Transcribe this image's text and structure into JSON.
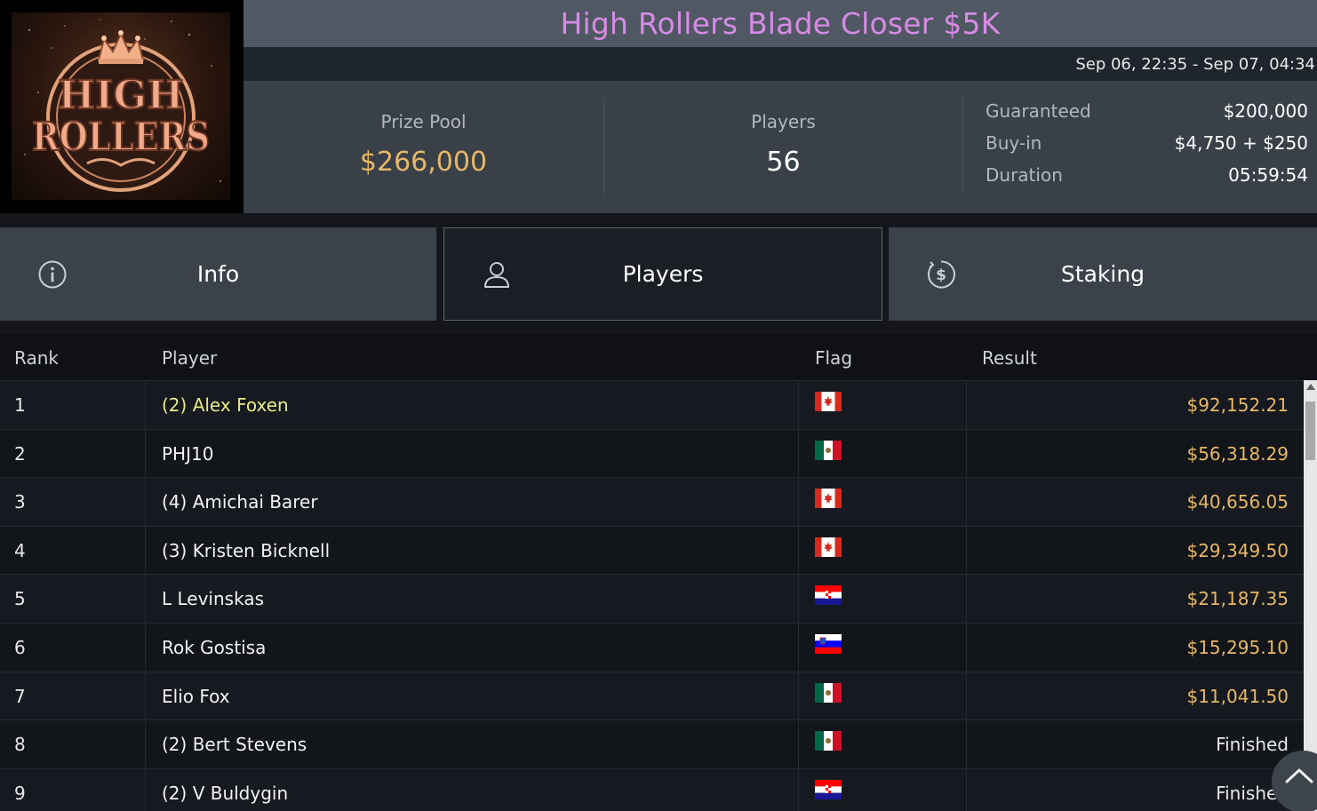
{
  "logo": {
    "line1": "HIGH",
    "line2": "ROLLERS"
  },
  "header": {
    "title": "High Rollers Blade Closer $5K",
    "date_range": "Sep 06, 22:35 - Sep 07, 04:34"
  },
  "stats": {
    "prize_pool_label": "Prize Pool",
    "prize_pool_value": "$266,000",
    "players_label": "Players",
    "players_value": "56",
    "details": [
      {
        "label": "Guaranteed",
        "value": "$200,000"
      },
      {
        "label": "Buy-in",
        "value": "$4,750 + $250"
      },
      {
        "label": "Duration",
        "value": "05:59:54"
      }
    ]
  },
  "tabs": [
    {
      "label": "Info",
      "icon": "info-icon"
    },
    {
      "label": "Players",
      "icon": "user-icon",
      "active": true
    },
    {
      "label": "Staking",
      "icon": "dollar-coin-icon"
    }
  ],
  "table": {
    "headers": {
      "rank": "Rank",
      "player": "Player",
      "flag": "Flag",
      "result": "Result"
    },
    "rows": [
      {
        "rank": "1",
        "player": "(2) Alex Foxen",
        "flag": "canada",
        "result": "$92,152.21",
        "highlight": true
      },
      {
        "rank": "2",
        "player": "PHJ10",
        "flag": "mexico",
        "result": "$56,318.29"
      },
      {
        "rank": "3",
        "player": "(4) Amichai Barer",
        "flag": "canada",
        "result": "$40,656.05"
      },
      {
        "rank": "4",
        "player": "(3) Kristen Bicknell",
        "flag": "canada",
        "result": "$29,349.50"
      },
      {
        "rank": "5",
        "player": "L Levinskas",
        "flag": "croatia",
        "result": "$21,187.35"
      },
      {
        "rank": "6",
        "player": "Rok Gostisa",
        "flag": "slovenia",
        "result": "$15,295.10"
      },
      {
        "rank": "7",
        "player": "Elio Fox",
        "flag": "mexico",
        "result": "$11,041.50"
      },
      {
        "rank": "8",
        "player": "(2) Bert Stevens",
        "flag": "mexico",
        "result": "Finished"
      },
      {
        "rank": "9",
        "player": "(2) V Buldygin",
        "flag": "croatia",
        "result": "Finished"
      }
    ]
  },
  "colors": {
    "title": "#d78be6",
    "prize": "#e7b768",
    "highlight_player": "#e9e98a",
    "result": "#e7b768"
  }
}
